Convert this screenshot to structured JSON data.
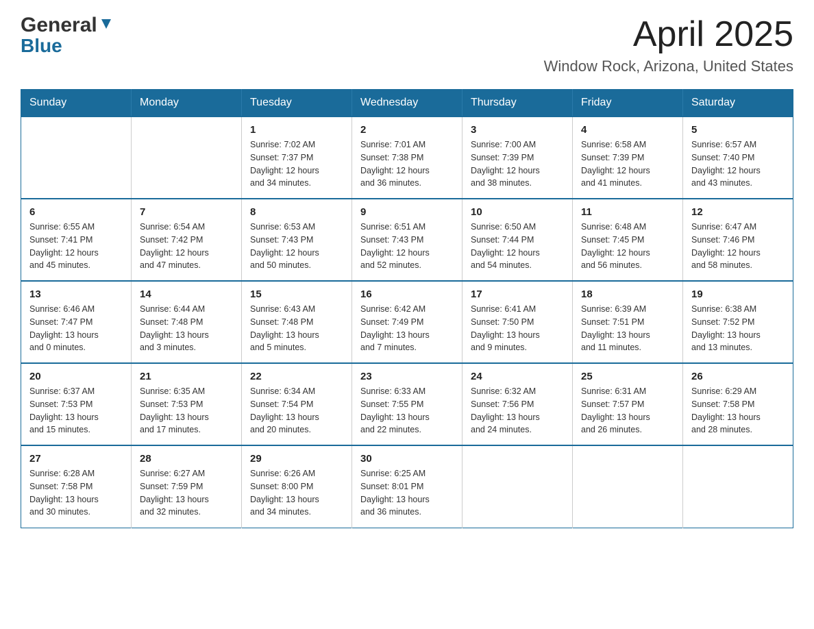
{
  "header": {
    "logo_general": "General",
    "logo_blue": "Blue",
    "month_title": "April 2025",
    "location": "Window Rock, Arizona, United States"
  },
  "calendar": {
    "days_of_week": [
      "Sunday",
      "Monday",
      "Tuesday",
      "Wednesday",
      "Thursday",
      "Friday",
      "Saturday"
    ],
    "weeks": [
      [
        {
          "day": "",
          "info": ""
        },
        {
          "day": "",
          "info": ""
        },
        {
          "day": "1",
          "info": "Sunrise: 7:02 AM\nSunset: 7:37 PM\nDaylight: 12 hours\nand 34 minutes."
        },
        {
          "day": "2",
          "info": "Sunrise: 7:01 AM\nSunset: 7:38 PM\nDaylight: 12 hours\nand 36 minutes."
        },
        {
          "day": "3",
          "info": "Sunrise: 7:00 AM\nSunset: 7:39 PM\nDaylight: 12 hours\nand 38 minutes."
        },
        {
          "day": "4",
          "info": "Sunrise: 6:58 AM\nSunset: 7:39 PM\nDaylight: 12 hours\nand 41 minutes."
        },
        {
          "day": "5",
          "info": "Sunrise: 6:57 AM\nSunset: 7:40 PM\nDaylight: 12 hours\nand 43 minutes."
        }
      ],
      [
        {
          "day": "6",
          "info": "Sunrise: 6:55 AM\nSunset: 7:41 PM\nDaylight: 12 hours\nand 45 minutes."
        },
        {
          "day": "7",
          "info": "Sunrise: 6:54 AM\nSunset: 7:42 PM\nDaylight: 12 hours\nand 47 minutes."
        },
        {
          "day": "8",
          "info": "Sunrise: 6:53 AM\nSunset: 7:43 PM\nDaylight: 12 hours\nand 50 minutes."
        },
        {
          "day": "9",
          "info": "Sunrise: 6:51 AM\nSunset: 7:43 PM\nDaylight: 12 hours\nand 52 minutes."
        },
        {
          "day": "10",
          "info": "Sunrise: 6:50 AM\nSunset: 7:44 PM\nDaylight: 12 hours\nand 54 minutes."
        },
        {
          "day": "11",
          "info": "Sunrise: 6:48 AM\nSunset: 7:45 PM\nDaylight: 12 hours\nand 56 minutes."
        },
        {
          "day": "12",
          "info": "Sunrise: 6:47 AM\nSunset: 7:46 PM\nDaylight: 12 hours\nand 58 minutes."
        }
      ],
      [
        {
          "day": "13",
          "info": "Sunrise: 6:46 AM\nSunset: 7:47 PM\nDaylight: 13 hours\nand 0 minutes."
        },
        {
          "day": "14",
          "info": "Sunrise: 6:44 AM\nSunset: 7:48 PM\nDaylight: 13 hours\nand 3 minutes."
        },
        {
          "day": "15",
          "info": "Sunrise: 6:43 AM\nSunset: 7:48 PM\nDaylight: 13 hours\nand 5 minutes."
        },
        {
          "day": "16",
          "info": "Sunrise: 6:42 AM\nSunset: 7:49 PM\nDaylight: 13 hours\nand 7 minutes."
        },
        {
          "day": "17",
          "info": "Sunrise: 6:41 AM\nSunset: 7:50 PM\nDaylight: 13 hours\nand 9 minutes."
        },
        {
          "day": "18",
          "info": "Sunrise: 6:39 AM\nSunset: 7:51 PM\nDaylight: 13 hours\nand 11 minutes."
        },
        {
          "day": "19",
          "info": "Sunrise: 6:38 AM\nSunset: 7:52 PM\nDaylight: 13 hours\nand 13 minutes."
        }
      ],
      [
        {
          "day": "20",
          "info": "Sunrise: 6:37 AM\nSunset: 7:53 PM\nDaylight: 13 hours\nand 15 minutes."
        },
        {
          "day": "21",
          "info": "Sunrise: 6:35 AM\nSunset: 7:53 PM\nDaylight: 13 hours\nand 17 minutes."
        },
        {
          "day": "22",
          "info": "Sunrise: 6:34 AM\nSunset: 7:54 PM\nDaylight: 13 hours\nand 20 minutes."
        },
        {
          "day": "23",
          "info": "Sunrise: 6:33 AM\nSunset: 7:55 PM\nDaylight: 13 hours\nand 22 minutes."
        },
        {
          "day": "24",
          "info": "Sunrise: 6:32 AM\nSunset: 7:56 PM\nDaylight: 13 hours\nand 24 minutes."
        },
        {
          "day": "25",
          "info": "Sunrise: 6:31 AM\nSunset: 7:57 PM\nDaylight: 13 hours\nand 26 minutes."
        },
        {
          "day": "26",
          "info": "Sunrise: 6:29 AM\nSunset: 7:58 PM\nDaylight: 13 hours\nand 28 minutes."
        }
      ],
      [
        {
          "day": "27",
          "info": "Sunrise: 6:28 AM\nSunset: 7:58 PM\nDaylight: 13 hours\nand 30 minutes."
        },
        {
          "day": "28",
          "info": "Sunrise: 6:27 AM\nSunset: 7:59 PM\nDaylight: 13 hours\nand 32 minutes."
        },
        {
          "day": "29",
          "info": "Sunrise: 6:26 AM\nSunset: 8:00 PM\nDaylight: 13 hours\nand 34 minutes."
        },
        {
          "day": "30",
          "info": "Sunrise: 6:25 AM\nSunset: 8:01 PM\nDaylight: 13 hours\nand 36 minutes."
        },
        {
          "day": "",
          "info": ""
        },
        {
          "day": "",
          "info": ""
        },
        {
          "day": "",
          "info": ""
        }
      ]
    ]
  }
}
